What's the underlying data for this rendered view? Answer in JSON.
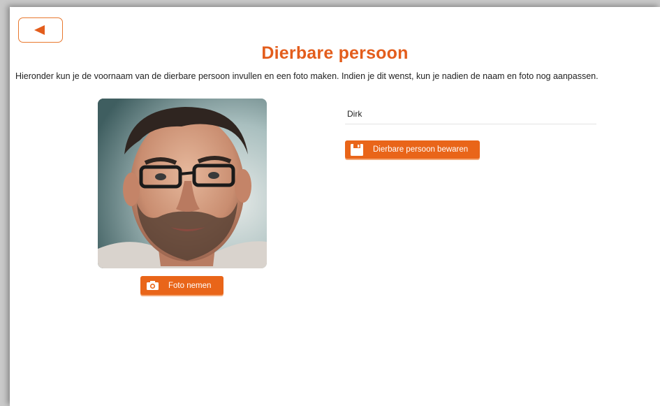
{
  "header": {
    "title": "Dierbare persoon",
    "back_icon": "back-arrow-icon"
  },
  "intro": {
    "text": "Hieronder kun je de voornaam van de dierbare persoon invullen en een foto maken. Indien je dit wenst, kun je nadien de naam en foto nog aanpassen."
  },
  "photo": {
    "take_photo_label": "Foto nemen",
    "take_photo_icon": "camera-icon"
  },
  "form": {
    "name_value": "Dirk",
    "save_label": "Dierbare persoon bewaren",
    "save_icon": "floppy-disk-icon"
  },
  "colors": {
    "accent": "#e96519",
    "title": "#e35d1c"
  }
}
